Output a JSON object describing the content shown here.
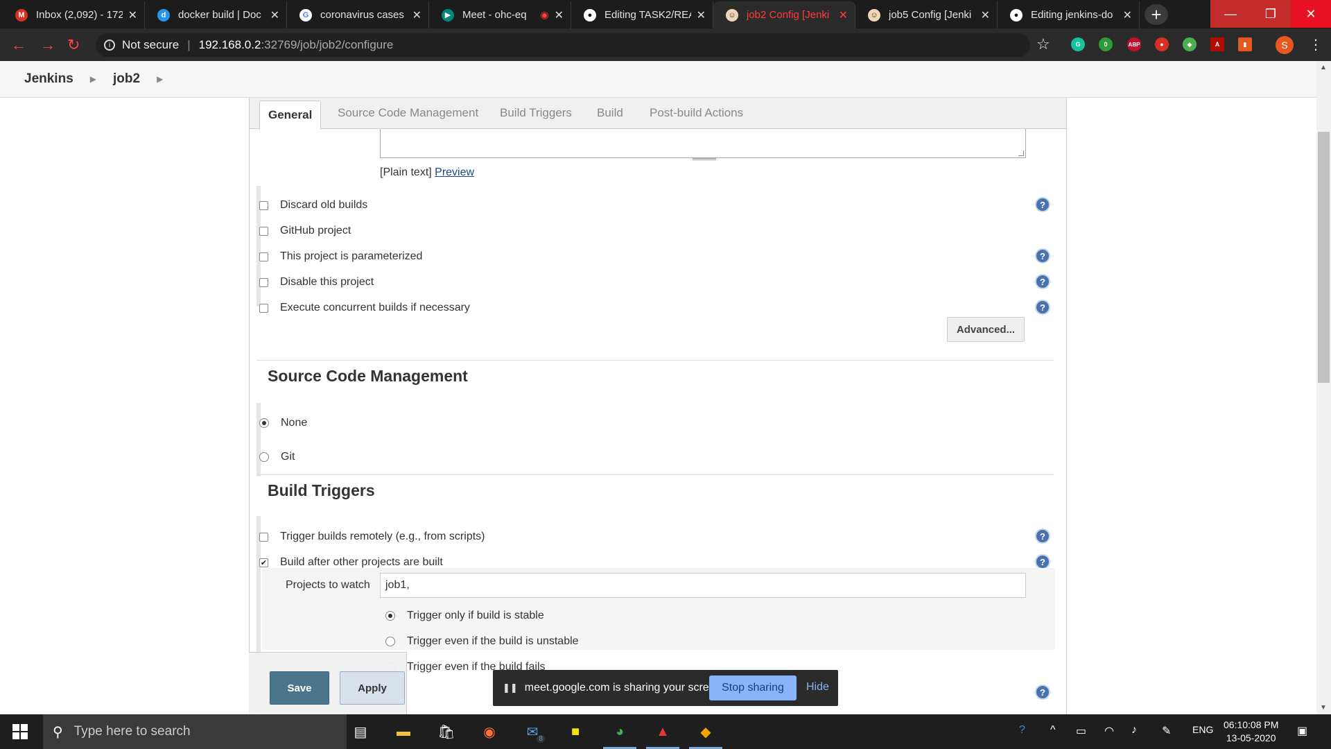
{
  "browser": {
    "tabs": [
      {
        "title": "Inbox (2,092) - 172",
        "favicon": "gmail-icon",
        "color": "#d93025"
      },
      {
        "title": "docker build | Doc",
        "favicon": "docker-icon",
        "color": "#2496ed"
      },
      {
        "title": "coronavirus cases",
        "favicon": "google-icon",
        "color": "#4285f4"
      },
      {
        "title": "Meet - ohc-eq",
        "favicon": "meet-icon",
        "color": "#00897b"
      },
      {
        "title": "Editing TASK2/REA",
        "favicon": "github-icon",
        "color": "#333333"
      },
      {
        "title": "job2 Config [Jenki",
        "favicon": "jenkins-icon",
        "color": "#d33833"
      },
      {
        "title": "job5 Config [Jenki",
        "favicon": "jenkins-icon",
        "color": "#d33833"
      },
      {
        "title": "Editing jenkins-do",
        "favicon": "github-icon",
        "color": "#333333"
      }
    ],
    "security_label": "Not secure",
    "url_host": "192.168.0.2",
    "url_path": ":32769/job/job2/configure",
    "profile_initial": "S",
    "ext_badge": "0",
    "ext_abp": "ABP"
  },
  "breadcrumb": {
    "root": "Jenkins",
    "job": "job2"
  },
  "config_tabs": [
    "General",
    "Source Code Management",
    "Build Triggers",
    "Build",
    "Post-build Actions"
  ],
  "description": {
    "plain_text": "[Plain text]",
    "preview": "Preview"
  },
  "general_options": [
    {
      "label": "Discard old builds",
      "checked": false,
      "help": true
    },
    {
      "label": "GitHub project",
      "checked": false,
      "help": false
    },
    {
      "label": "This project is parameterized",
      "checked": false,
      "help": true
    },
    {
      "label": "Disable this project",
      "checked": false,
      "help": true
    },
    {
      "label": "Execute concurrent builds if necessary",
      "checked": false,
      "help": true
    }
  ],
  "advanced_label": "Advanced...",
  "scm": {
    "title": "Source Code Management",
    "options": [
      {
        "label": "None",
        "selected": true
      },
      {
        "label": "Git",
        "selected": false
      }
    ]
  },
  "build_triggers": {
    "title": "Build Triggers",
    "options": [
      {
        "label": "Trigger builds remotely (e.g., from scripts)",
        "checked": false
      },
      {
        "label": "Build after other projects are built",
        "checked": true
      }
    ],
    "projects_label": "Projects to watch",
    "projects_value": "job1,",
    "trigger_modes": [
      {
        "label": "Trigger only if build is stable",
        "selected": true
      },
      {
        "label": "Trigger even if the build is unstable",
        "selected": false
      },
      {
        "label": "Trigger even if the build fails",
        "selected": false
      }
    ]
  },
  "actions": {
    "save": "Save",
    "apply": "Apply"
  },
  "meet_banner": {
    "message": "meet.google.com is sharing your screen.",
    "stop": "Stop sharing",
    "hide": "Hide"
  },
  "taskbar": {
    "search_placeholder": "Type here to search",
    "mail_badge": "8",
    "language": "ENG",
    "time": "06:10:08 PM",
    "date": "13-05-2020"
  }
}
